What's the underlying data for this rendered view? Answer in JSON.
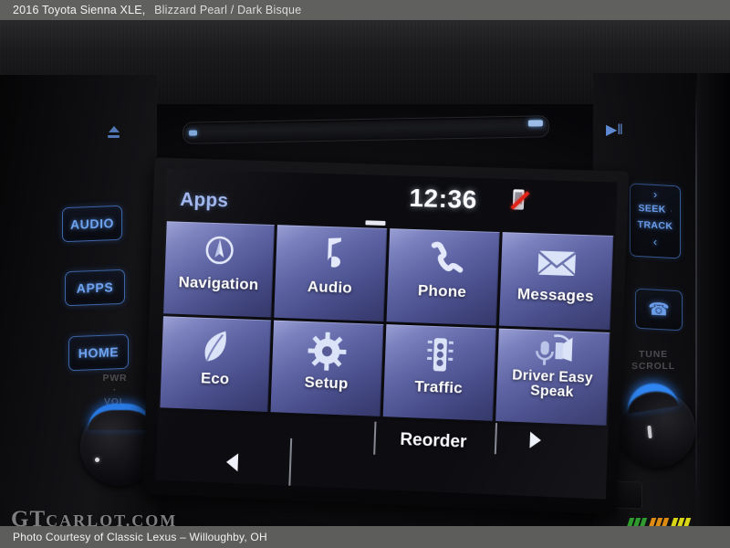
{
  "top_caption": {
    "vehicle": "2016 Toyota Sienna XLE,",
    "trim": "Blizzard Pearl / Dark Bisque"
  },
  "bottom_caption": {
    "text": "Photo Courtesy of Classic Lexus – Willoughby, OH"
  },
  "watermark": {
    "prefix": "GT",
    "suffix": "CARLOT.COM"
  },
  "head_unit": {
    "cd_slot": {
      "eject_label": "eject-icon",
      "play_pause_label": "▶‖"
    },
    "hard_buttons_left": [
      {
        "label": "AUDIO",
        "name": "audio-button"
      },
      {
        "label": "APPS",
        "name": "apps-button"
      },
      {
        "label": "HOME",
        "name": "home-button"
      }
    ],
    "hard_buttons_right": {
      "seek_track": {
        "chevron_up": "›",
        "line1": "SEEK",
        "dot": "·",
        "line2": "TRACK",
        "chevron_down": "‹"
      },
      "phone": "☎"
    },
    "knobs": {
      "volume_label_line1": "PWR",
      "volume_label_dot": "·",
      "volume_label_line2": "VOL",
      "tune_label_line1": "TUNE",
      "tune_label_line2": "SCROLL"
    }
  },
  "screen": {
    "status": {
      "title": "Apps",
      "clock": "12:36",
      "phone_icon": "phone-disconnected-icon"
    },
    "tiles": [
      {
        "label": "Navigation",
        "icon": "compass-icon",
        "two_line": false
      },
      {
        "label": "Audio",
        "icon": "music-note-icon",
        "two_line": false
      },
      {
        "label": "Phone",
        "icon": "phone-icon",
        "two_line": false
      },
      {
        "label": "Messages",
        "icon": "envelope-icon",
        "two_line": false
      },
      {
        "label": "Eco",
        "icon": "leaf-icon",
        "two_line": false
      },
      {
        "label": "Setup",
        "icon": "gear-icon",
        "two_line": false
      },
      {
        "label": "Traffic",
        "icon": "traffic-light-icon",
        "two_line": false
      },
      {
        "label": "Driver Easy Speak",
        "icon": "microphone-speaker-icon",
        "two_line": true
      }
    ],
    "bottom_bar": {
      "prev_label": "previous-page-arrow",
      "reorder_label": "Reorder",
      "next_label": "next-page-arrow"
    }
  },
  "colors": {
    "caption_bar": "#60605f",
    "tile_light": "#9aa0d4",
    "tile_dark": "#343869",
    "backlight_blue": "#6fa2ef",
    "status_red": "#e02418",
    "bar_green": "#2f9b2f",
    "bar_orange": "#dd8b12",
    "bar_yellow": "#d9d617"
  }
}
